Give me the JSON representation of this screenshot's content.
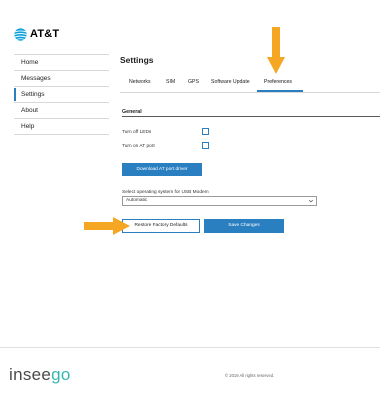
{
  "header": {
    "logo_text": "AT&T"
  },
  "sidebar": {
    "items": [
      {
        "label": "Home"
      },
      {
        "label": "Messages"
      },
      {
        "label": "Settings"
      },
      {
        "label": "About"
      },
      {
        "label": "Help"
      }
    ],
    "active_index": 2
  },
  "main": {
    "title": "Settings",
    "tabs": [
      {
        "label": "Networks"
      },
      {
        "label": "SIM"
      },
      {
        "label": "GPS"
      },
      {
        "label": "Software Update"
      },
      {
        "label": "Preferences"
      }
    ],
    "active_tab": "Preferences",
    "section_title": "General",
    "options": [
      {
        "label": "Turn off LEDs",
        "checked": false
      },
      {
        "label": "Turn on AT port",
        "checked": false
      }
    ],
    "download_button": "Download AT port driver",
    "select_label": "Select operating system for USB Modem",
    "select_value": "Automatic",
    "restore_button": "Restore Factory Defaults",
    "save_button": "Save Changes"
  },
  "footer": {
    "brand_main": "insee",
    "brand_accent": "go",
    "copyright": "© 2019 All rights reserved."
  },
  "colors": {
    "accent": "#2a7fc1",
    "highlight_arrow": "#f5a623",
    "brand_accent": "#36b6b0"
  },
  "icons": [
    "att-globe-icon",
    "checkbox-icon",
    "chevron-down-icon",
    "arrow-down-icon",
    "arrow-right-icon"
  ]
}
